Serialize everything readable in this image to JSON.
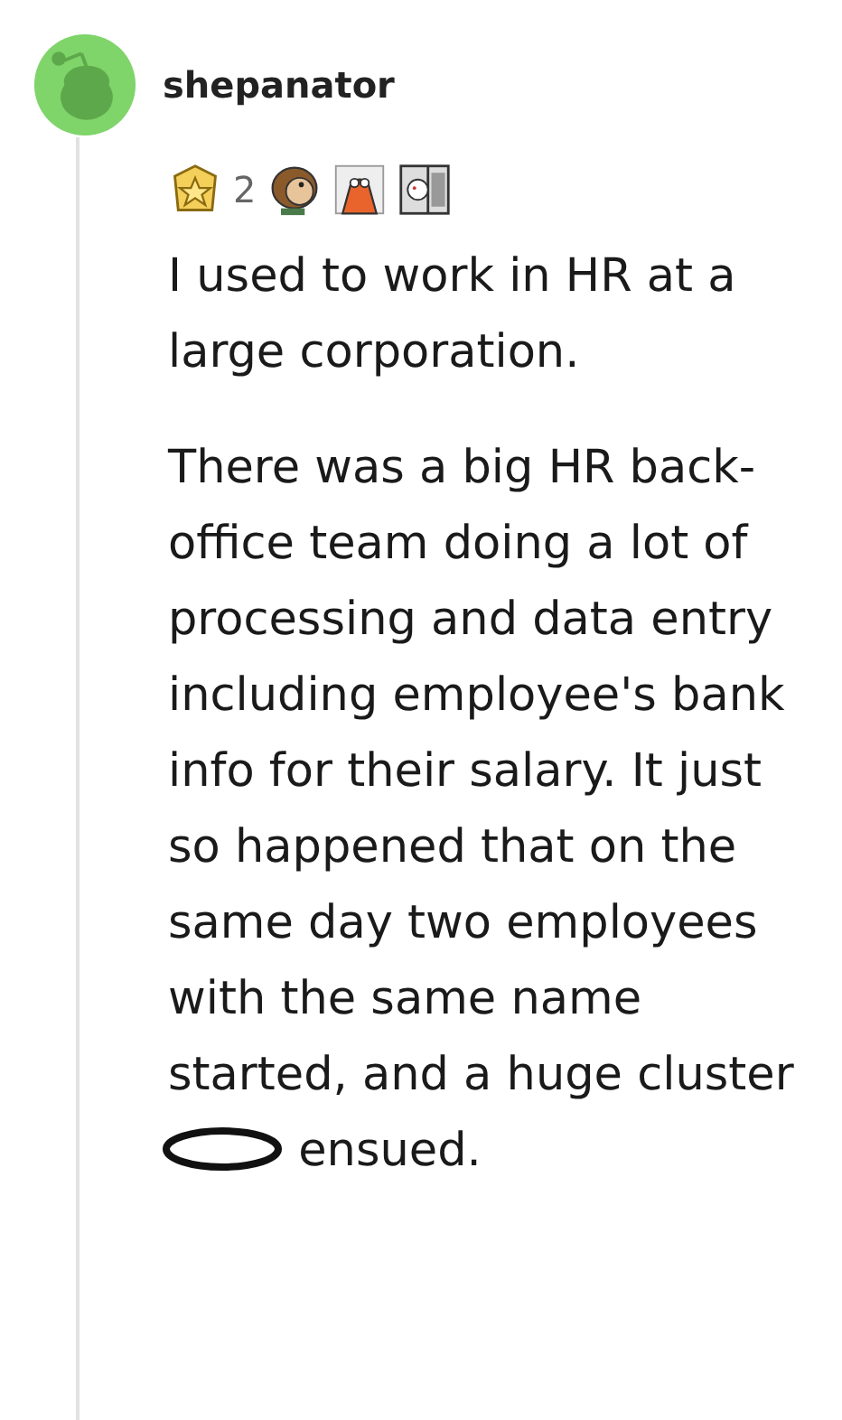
{
  "comment": {
    "author": "shepanator",
    "awards": [
      {
        "kind": "star-badge",
        "count": "2"
      },
      {
        "kind": "monkey"
      },
      {
        "kind": "orange-figure"
      },
      {
        "kind": "framed-figure"
      }
    ],
    "paragraphs": [
      {
        "text": "I used to work in HR at a large corporation."
      },
      {
        "text": "There was a big HR back-office team doing a lot of processing and data entry including employee's bank info for their salary. It just so happened that on the same day two employees with the same name started, and a huge cluster",
        "after_mark": "ensued."
      }
    ]
  }
}
